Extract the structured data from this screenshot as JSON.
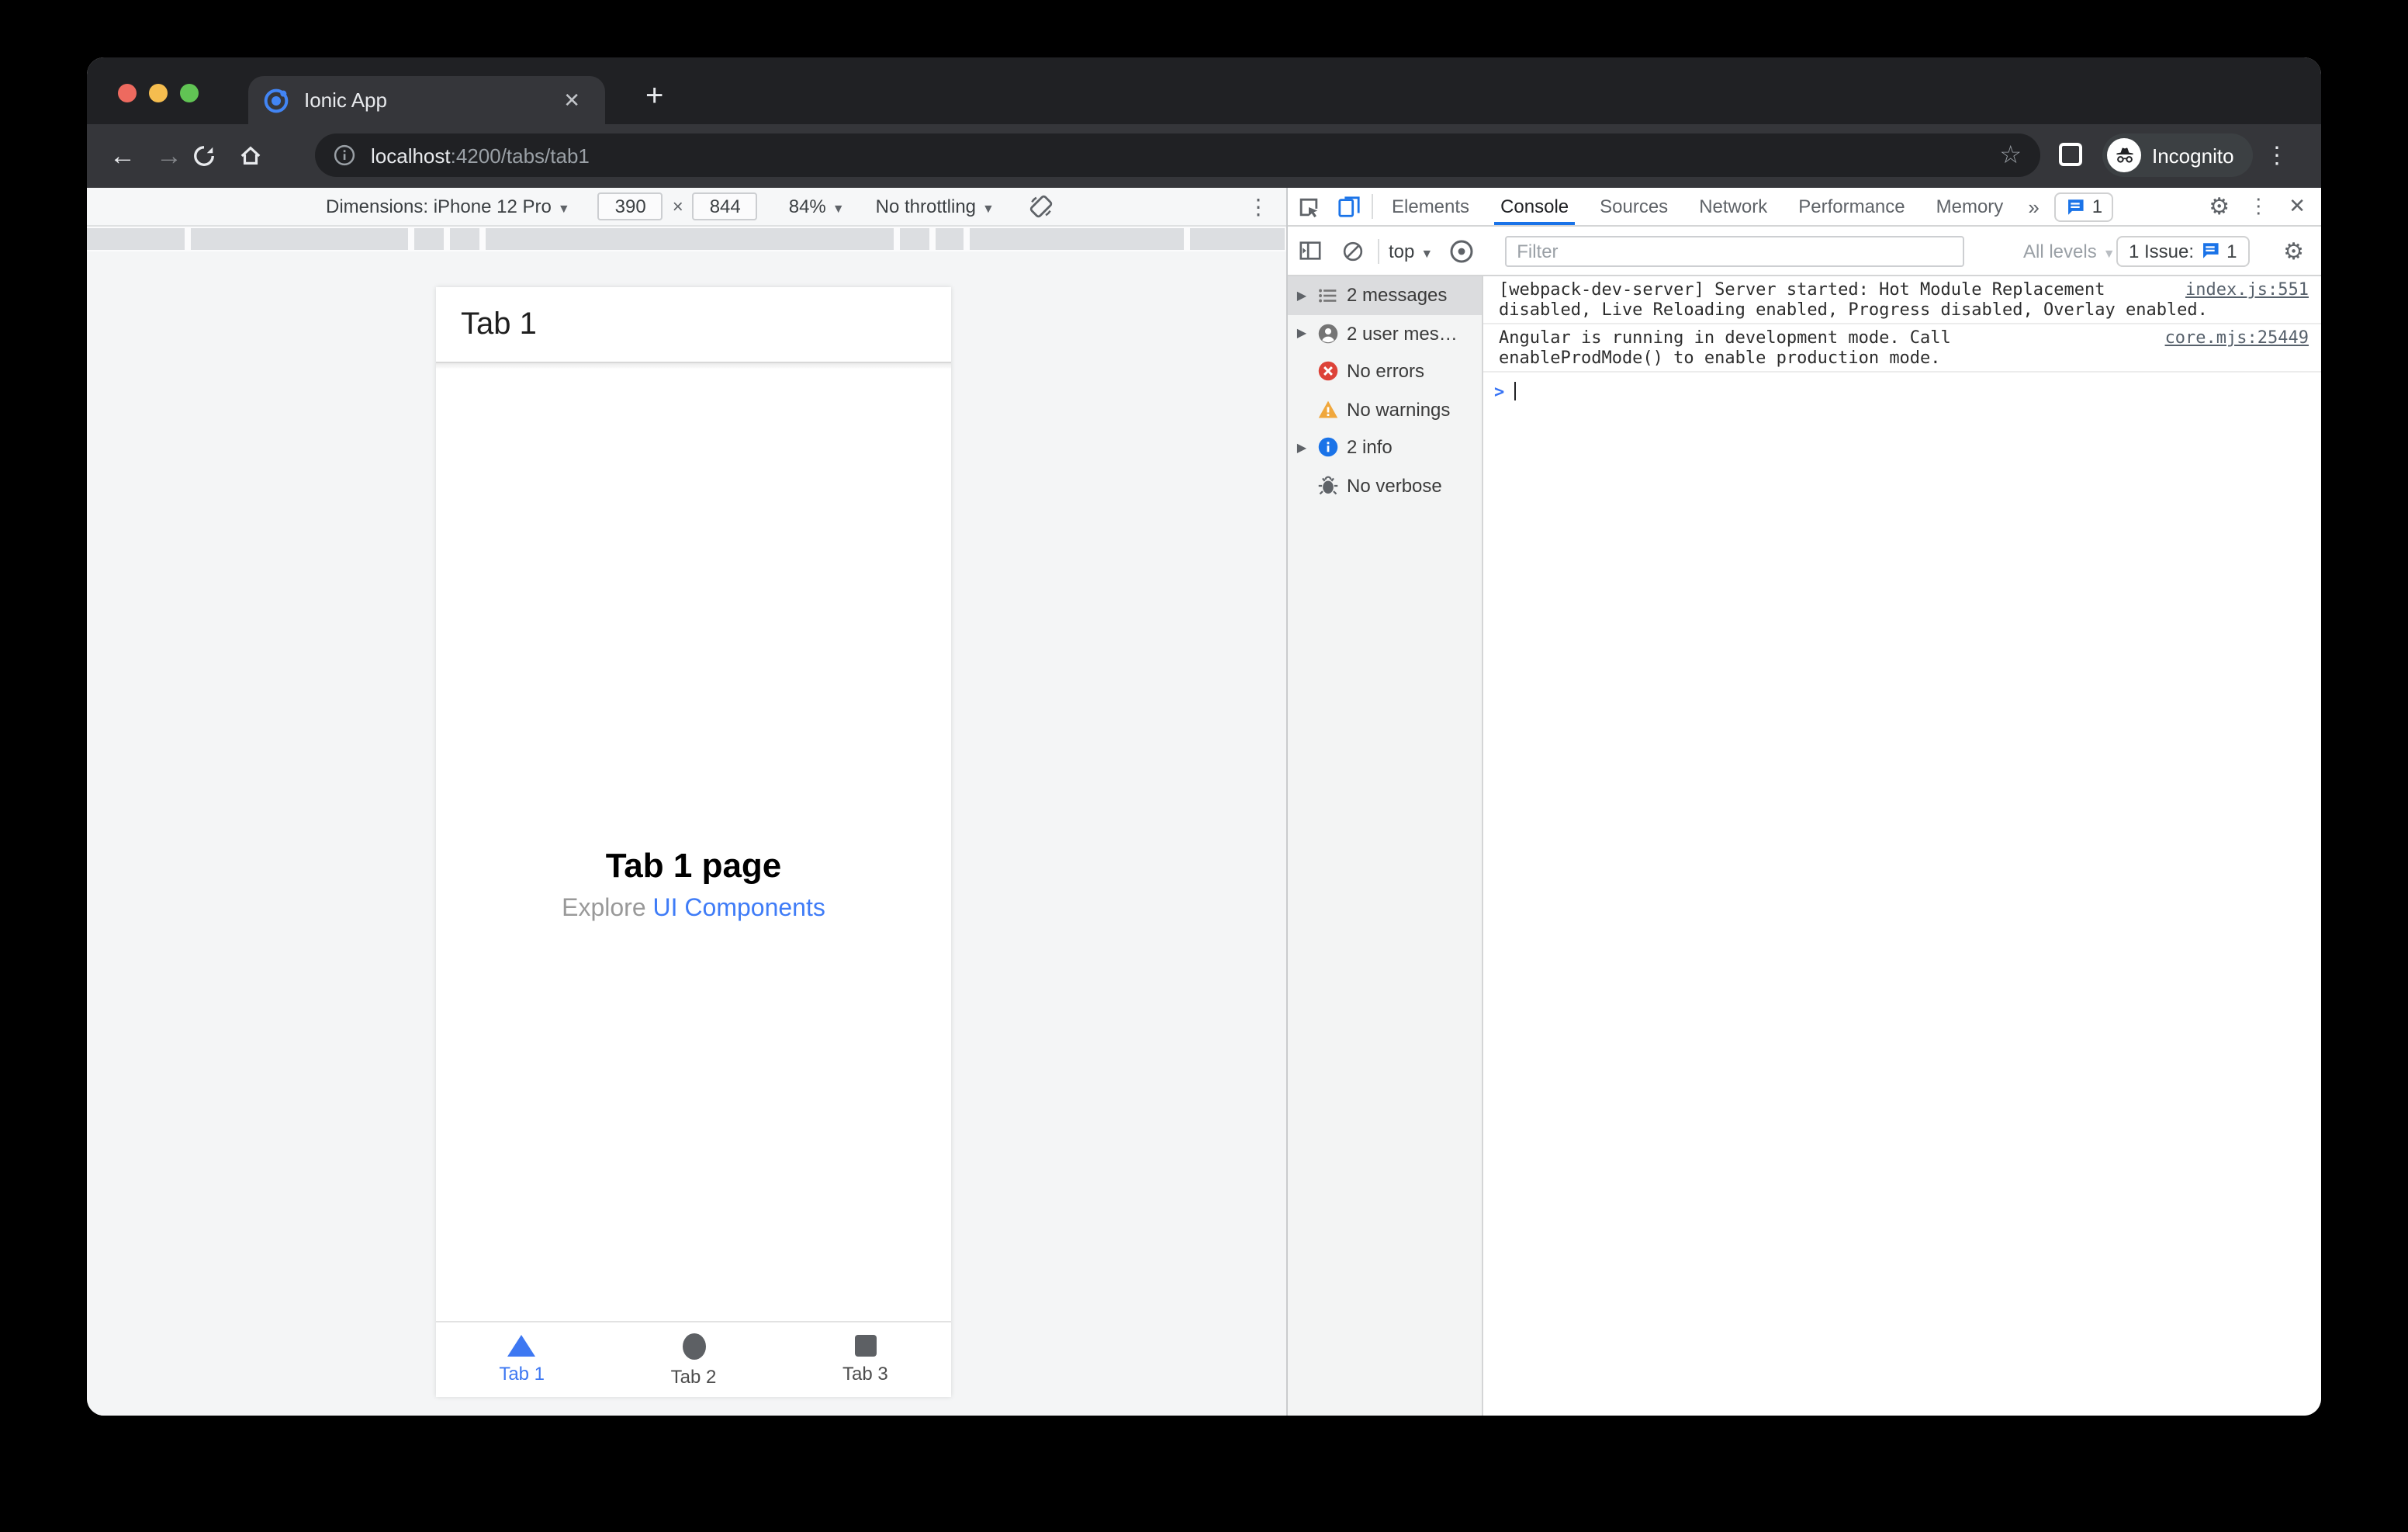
{
  "browser": {
    "tab_title": "Ionic App",
    "url_host": "localhost",
    "url_rest": ":4200/tabs/tab1",
    "incognito_label": "Incognito"
  },
  "device_toolbar": {
    "dimensions_label": "Dimensions: iPhone 12 Pro",
    "width_value": "390",
    "separator": "×",
    "height_value": "844",
    "zoom_value": "84%",
    "throttling_value": "No throttling"
  },
  "devtools": {
    "tabs": [
      {
        "label": "Elements"
      },
      {
        "label": "Console"
      },
      {
        "label": "Sources"
      },
      {
        "label": "Network"
      },
      {
        "label": "Performance"
      },
      {
        "label": "Memory"
      }
    ],
    "more_tabs_glyph": "»",
    "issues_tab_count": "1",
    "console_toolbar": {
      "context_value": "top",
      "filter_placeholder": "Filter",
      "levels_value": "All levels",
      "issue_button_label": "1 Issue:",
      "issue_button_count": "1"
    },
    "sidebar": {
      "items": [
        {
          "label": "2 messages",
          "icon": "list-icon",
          "selected": true
        },
        {
          "label": "2 user mes…",
          "icon": "user-icon",
          "selected": false
        },
        {
          "label": "No errors",
          "icon": "error-icon",
          "selected": false
        },
        {
          "label": "No warnings",
          "icon": "warning-icon",
          "selected": false
        },
        {
          "label": "2 info",
          "icon": "info-icon",
          "selected": false
        },
        {
          "label": "No verbose",
          "icon": "verbose-icon",
          "selected": false
        }
      ]
    },
    "messages": [
      {
        "text": "[webpack-dev-server] Server started: Hot Module Replacement\ndisabled, Live Reloading enabled, Progress disabled, Overlay enabled.",
        "source": "index.js:551"
      },
      {
        "text": "Angular is running in development mode. Call\nenableProdMode() to enable production mode.",
        "source": "core.mjs:25449"
      }
    ],
    "prompt_glyph": ">"
  },
  "app": {
    "header_title": "Tab 1",
    "heading": "Tab 1 page",
    "subtitle_prefix": "Explore ",
    "subtitle_link": "UI Components",
    "tabs": [
      {
        "label": "Tab 1",
        "icon": "triangle-icon",
        "active": true
      },
      {
        "label": "Tab 2",
        "icon": "circle-icon",
        "active": false
      },
      {
        "label": "Tab 3",
        "icon": "square-icon",
        "active": false
      }
    ]
  },
  "colors": {
    "devtools_accent": "#1a73e8",
    "ionic_blue": "#3e78f2",
    "error_red": "#dd4238",
    "warning_yellow": "#f0a73c",
    "traffic_red": "#ed6a5f",
    "traffic_yellow": "#f5bd4f",
    "traffic_green": "#61c454"
  }
}
